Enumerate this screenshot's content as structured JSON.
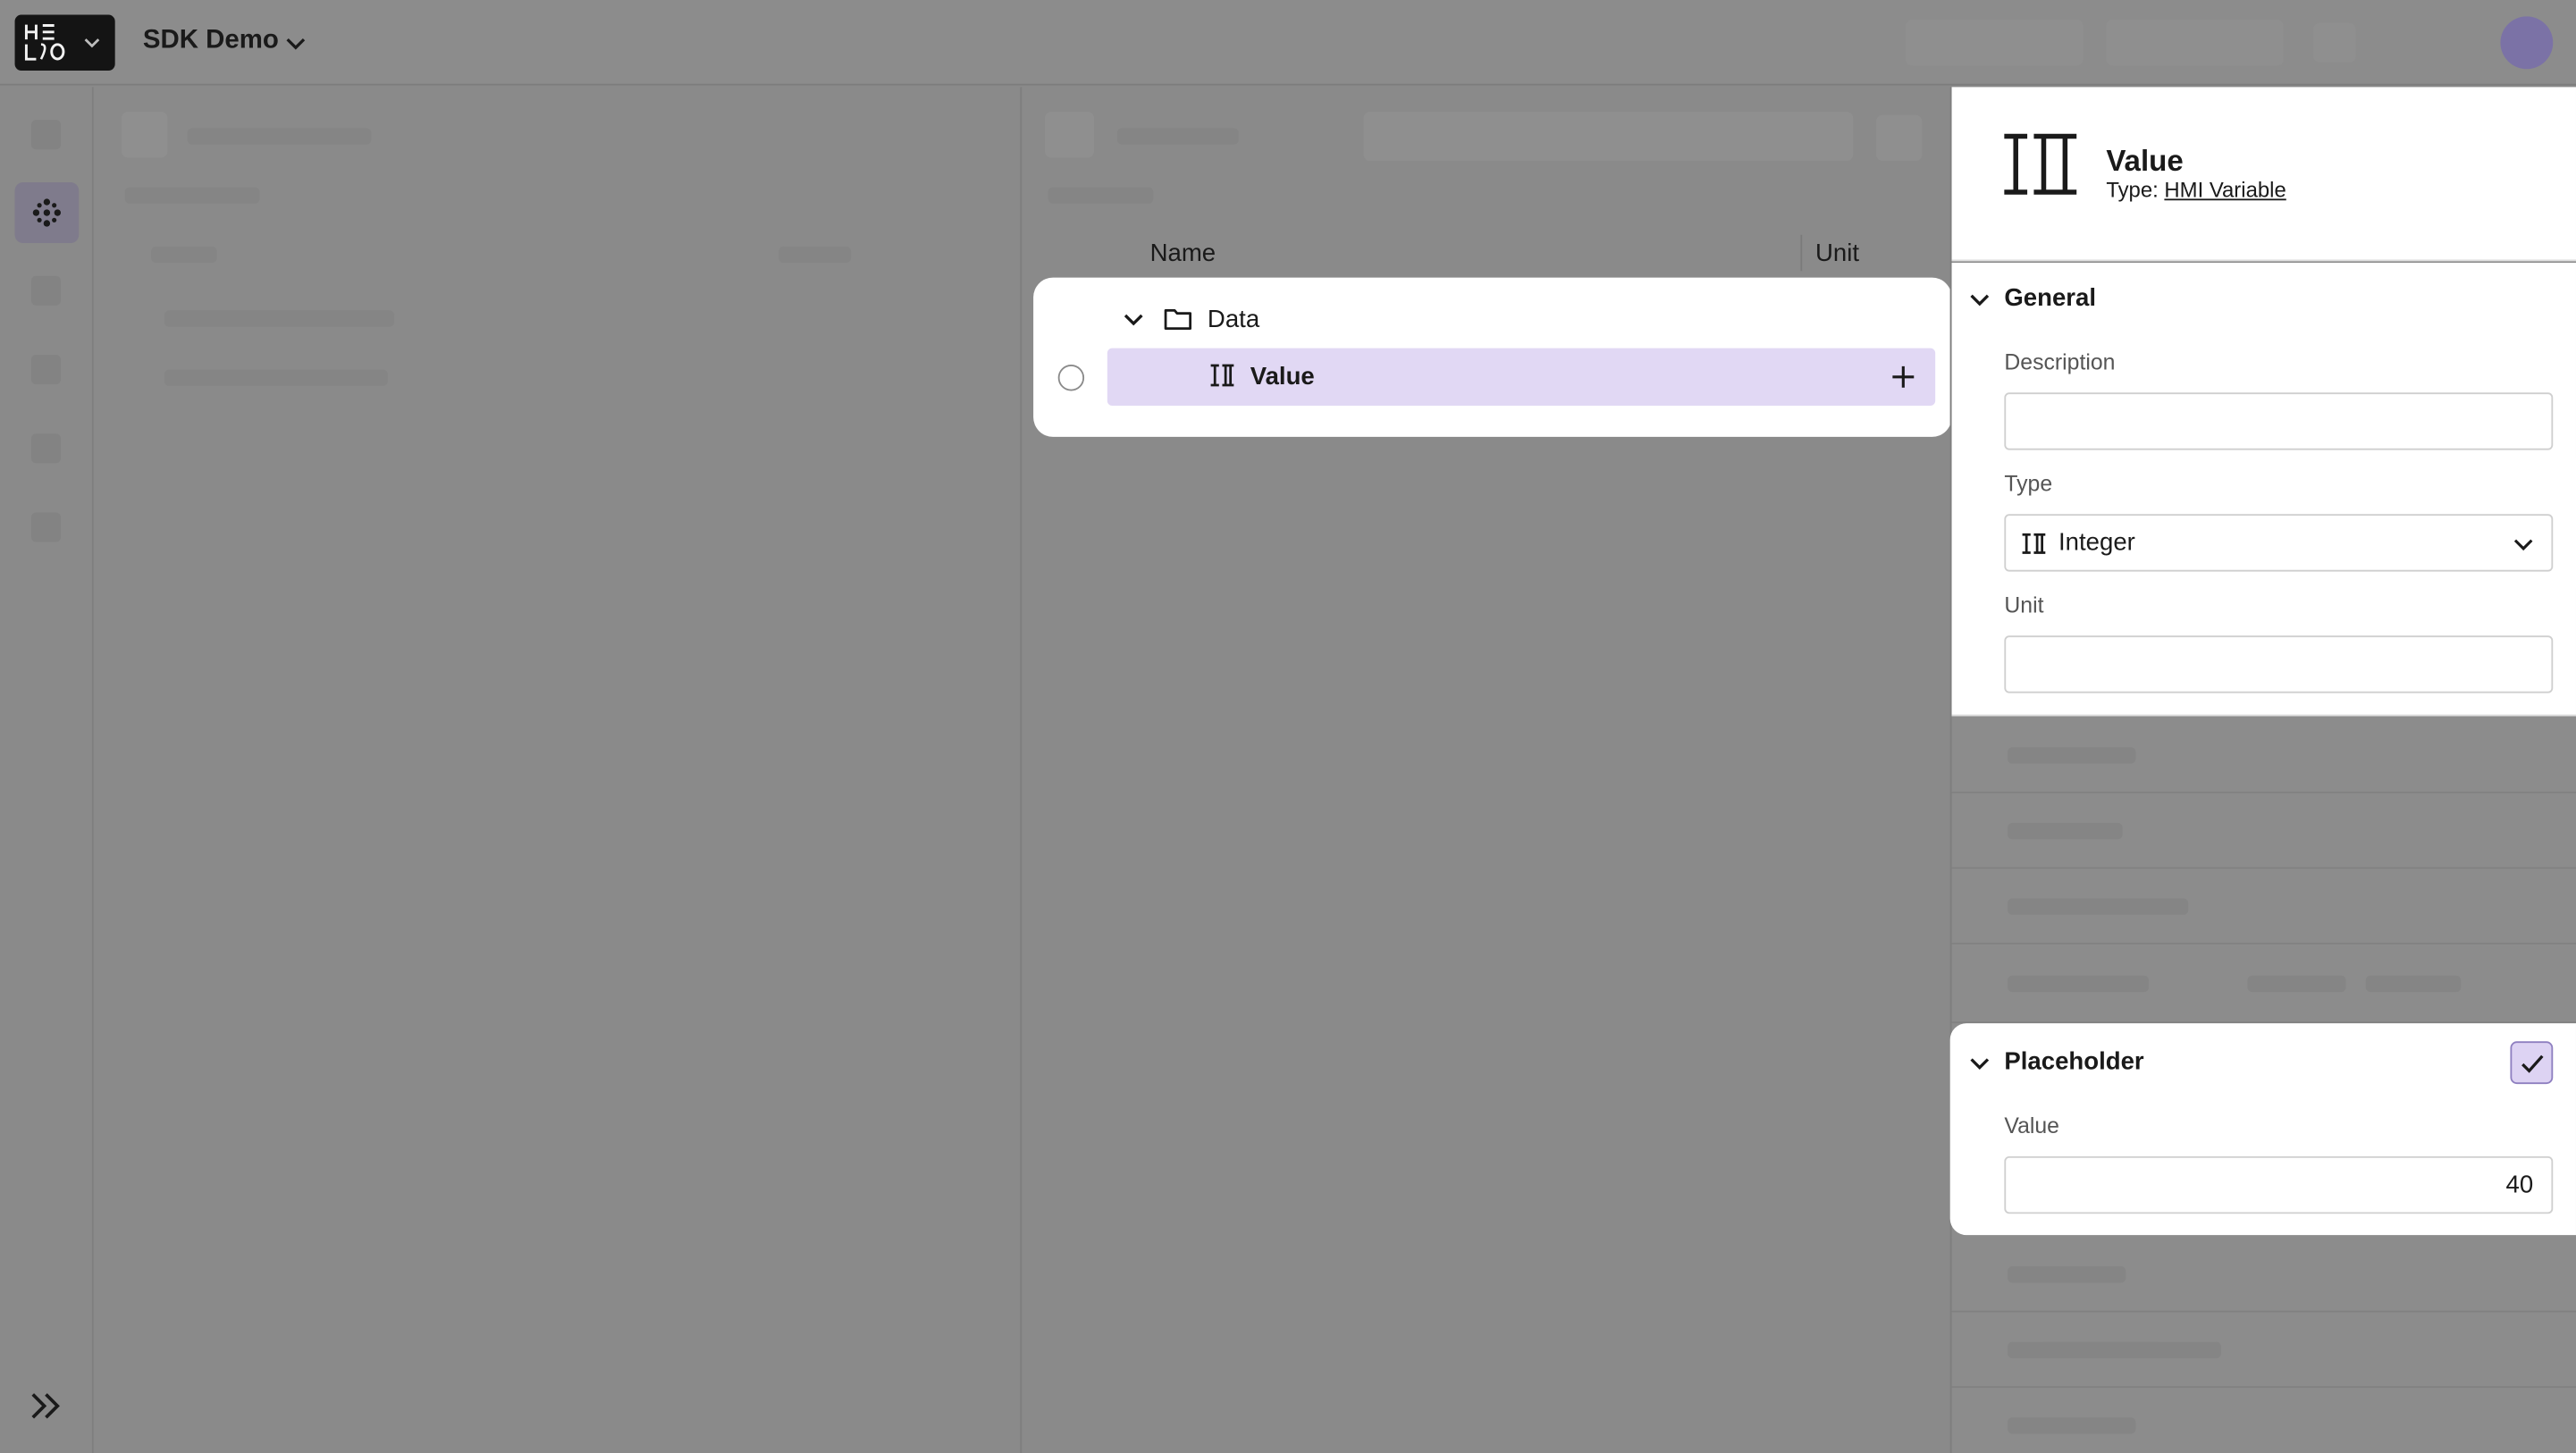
{
  "app": {
    "title": "SDK Demo",
    "logo_text": "HE\nLO"
  },
  "table": {
    "col_name": "Name",
    "col_unit": "Unit",
    "tree": {
      "folder_label": "Data",
      "item_label": "Value"
    }
  },
  "inspector": {
    "title": "Value",
    "type_prefix": "Type:",
    "type_link": "HMI Variable",
    "general": {
      "title": "General",
      "description_label": "Description",
      "description_value": "",
      "type_label": "Type",
      "type_value": "Integer",
      "unit_label": "Unit",
      "unit_value": ""
    },
    "placeholder": {
      "title": "Placeholder",
      "checked": true,
      "value_label": "Value",
      "value": "40"
    }
  },
  "colors": {
    "accent_bg": "#e1d8f4",
    "checkbox_bg": "#ddd3f3",
    "overlay": "#8a8a8a"
  },
  "icons": {
    "variable": "variable-integer-icon",
    "folder": "folder-icon",
    "expand": "double-chevron-right-icon"
  }
}
